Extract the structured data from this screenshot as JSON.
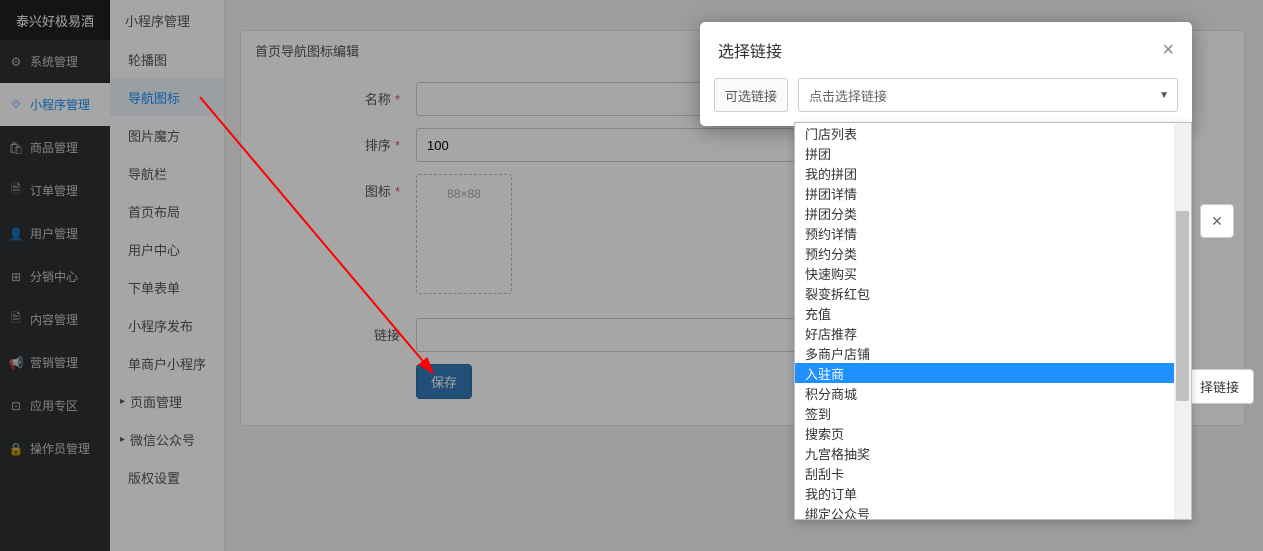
{
  "brand": "泰兴好极易酒",
  "leftnav": {
    "items": [
      {
        "icon": "⚙",
        "label": "系统管理"
      },
      {
        "icon": "⟐",
        "label": "小程序管理",
        "active": true
      },
      {
        "icon": "🛍",
        "label": "商品管理"
      },
      {
        "icon": "🗎",
        "label": "订单管理"
      },
      {
        "icon": "👤",
        "label": "用户管理"
      },
      {
        "icon": "⊞",
        "label": "分销中心"
      },
      {
        "icon": "🖹",
        "label": "内容管理"
      },
      {
        "icon": "📢",
        "label": "营销管理"
      },
      {
        "icon": "⊡",
        "label": "应用专区"
      },
      {
        "icon": "🔒",
        "label": "操作员管理"
      }
    ]
  },
  "subnav": {
    "header": "小程序管理",
    "items": [
      "轮播图",
      "导航图标",
      "图片魔方",
      "导航栏",
      "首页布局",
      "用户中心",
      "下单表单",
      "小程序发布",
      "单商户小程序"
    ],
    "active": "导航图标",
    "expandable": [
      {
        "label": "页面管理"
      },
      {
        "label": "微信公众号"
      }
    ],
    "tail": "版权设置"
  },
  "panel": {
    "title": "首页导航图标编辑",
    "fields": {
      "name_label": "名称",
      "sort_label": "排序",
      "sort_value": "100",
      "icon_label": "图标",
      "icon_placeholder": "88×88",
      "link_label": "链接",
      "link_btn": "择链接"
    },
    "save_btn": "保存"
  },
  "modal": {
    "title": "选择链接",
    "tag": "可选链接",
    "placeholder": "点击选择链接",
    "options": [
      "门店列表",
      "拼团",
      "我的拼团",
      "拼团详情",
      "拼团分类",
      "预约详情",
      "预约分类",
      "快速购买",
      "裂变拆红包",
      "充值",
      "好店推荐",
      "多商户店铺",
      "入驻商",
      "积分商城",
      "签到",
      "搜索页",
      "九宫格抽奖",
      "刮刮卡",
      "我的订单",
      "绑定公众号"
    ],
    "highlight": "入驻商"
  }
}
